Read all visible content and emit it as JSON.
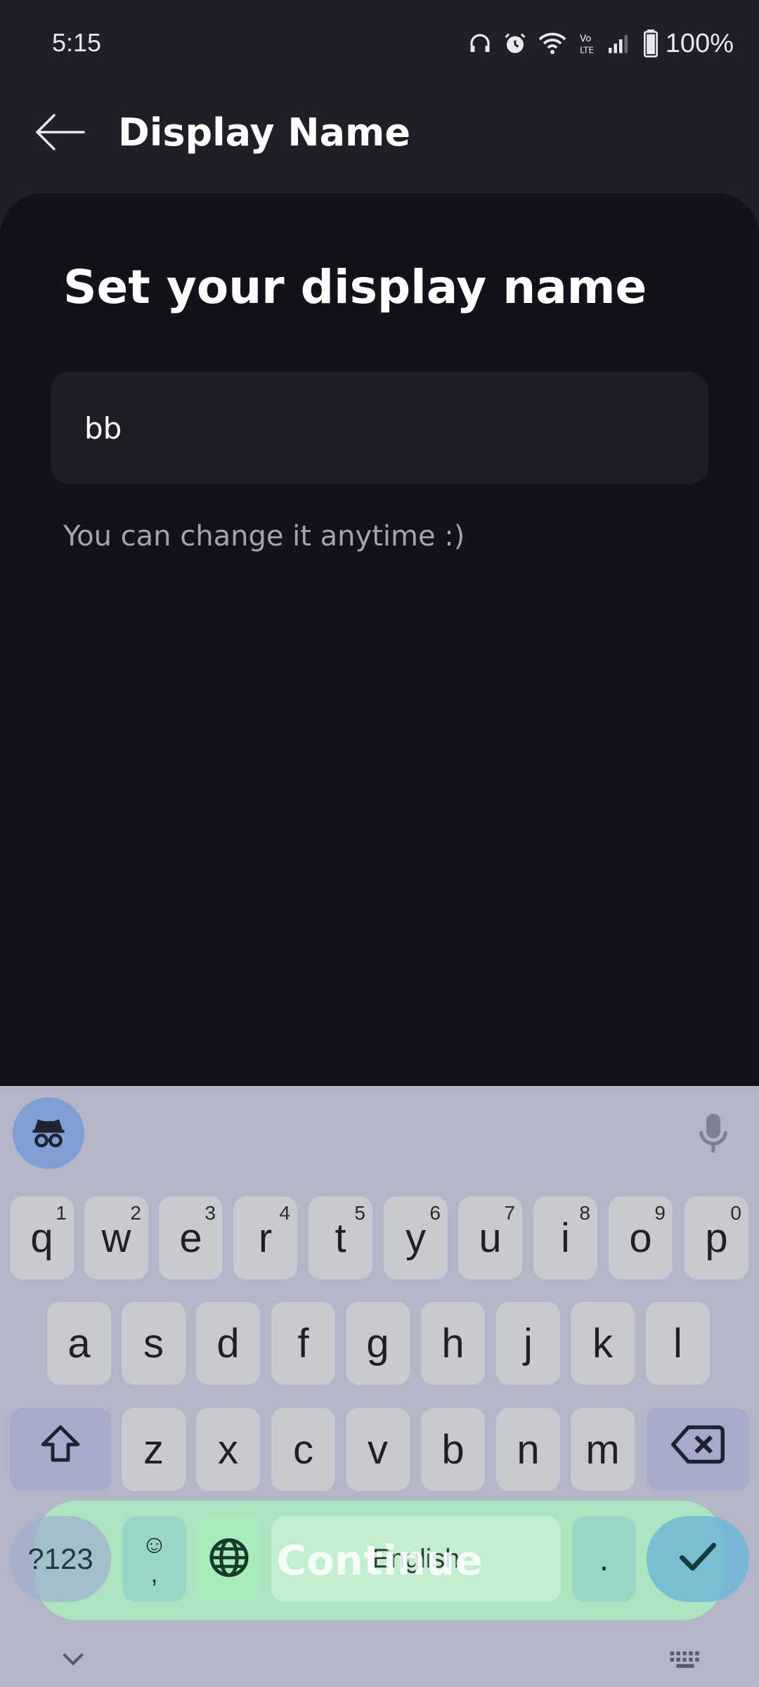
{
  "status_bar": {
    "time": "5:15",
    "battery": "100%",
    "icons": [
      "headphones-icon",
      "alarm-icon",
      "wifi-icon",
      "volte-icon",
      "signal-icon",
      "battery-icon"
    ]
  },
  "app_bar": {
    "title": "Display Name",
    "back_icon": "arrow-left-icon"
  },
  "main": {
    "heading": "Set your display name",
    "name_input": {
      "value": "bb",
      "placeholder": ""
    },
    "hint": "You can change it anytime :)",
    "continue_label": "Continue"
  },
  "keyboard": {
    "row1": [
      {
        "key": "q",
        "hint": "1"
      },
      {
        "key": "w",
        "hint": "2"
      },
      {
        "key": "e",
        "hint": "3"
      },
      {
        "key": "r",
        "hint": "4"
      },
      {
        "key": "t",
        "hint": "5"
      },
      {
        "key": "y",
        "hint": "6"
      },
      {
        "key": "u",
        "hint": "7"
      },
      {
        "key": "i",
        "hint": "8"
      },
      {
        "key": "o",
        "hint": "9"
      },
      {
        "key": "p",
        "hint": "0"
      }
    ],
    "row2": [
      "a",
      "s",
      "d",
      "f",
      "g",
      "h",
      "j",
      "k",
      "l"
    ],
    "row3": [
      "z",
      "x",
      "c",
      "v",
      "b",
      "n",
      "m"
    ],
    "symbols_label": "?123",
    "emoji_top": "☺",
    "emoji_bottom": ",",
    "space_label": "English",
    "period_label": ".",
    "colors": {
      "incognito": "#7f9fd4",
      "background": "#b2b6c6",
      "continue": "#aaecbe"
    }
  }
}
